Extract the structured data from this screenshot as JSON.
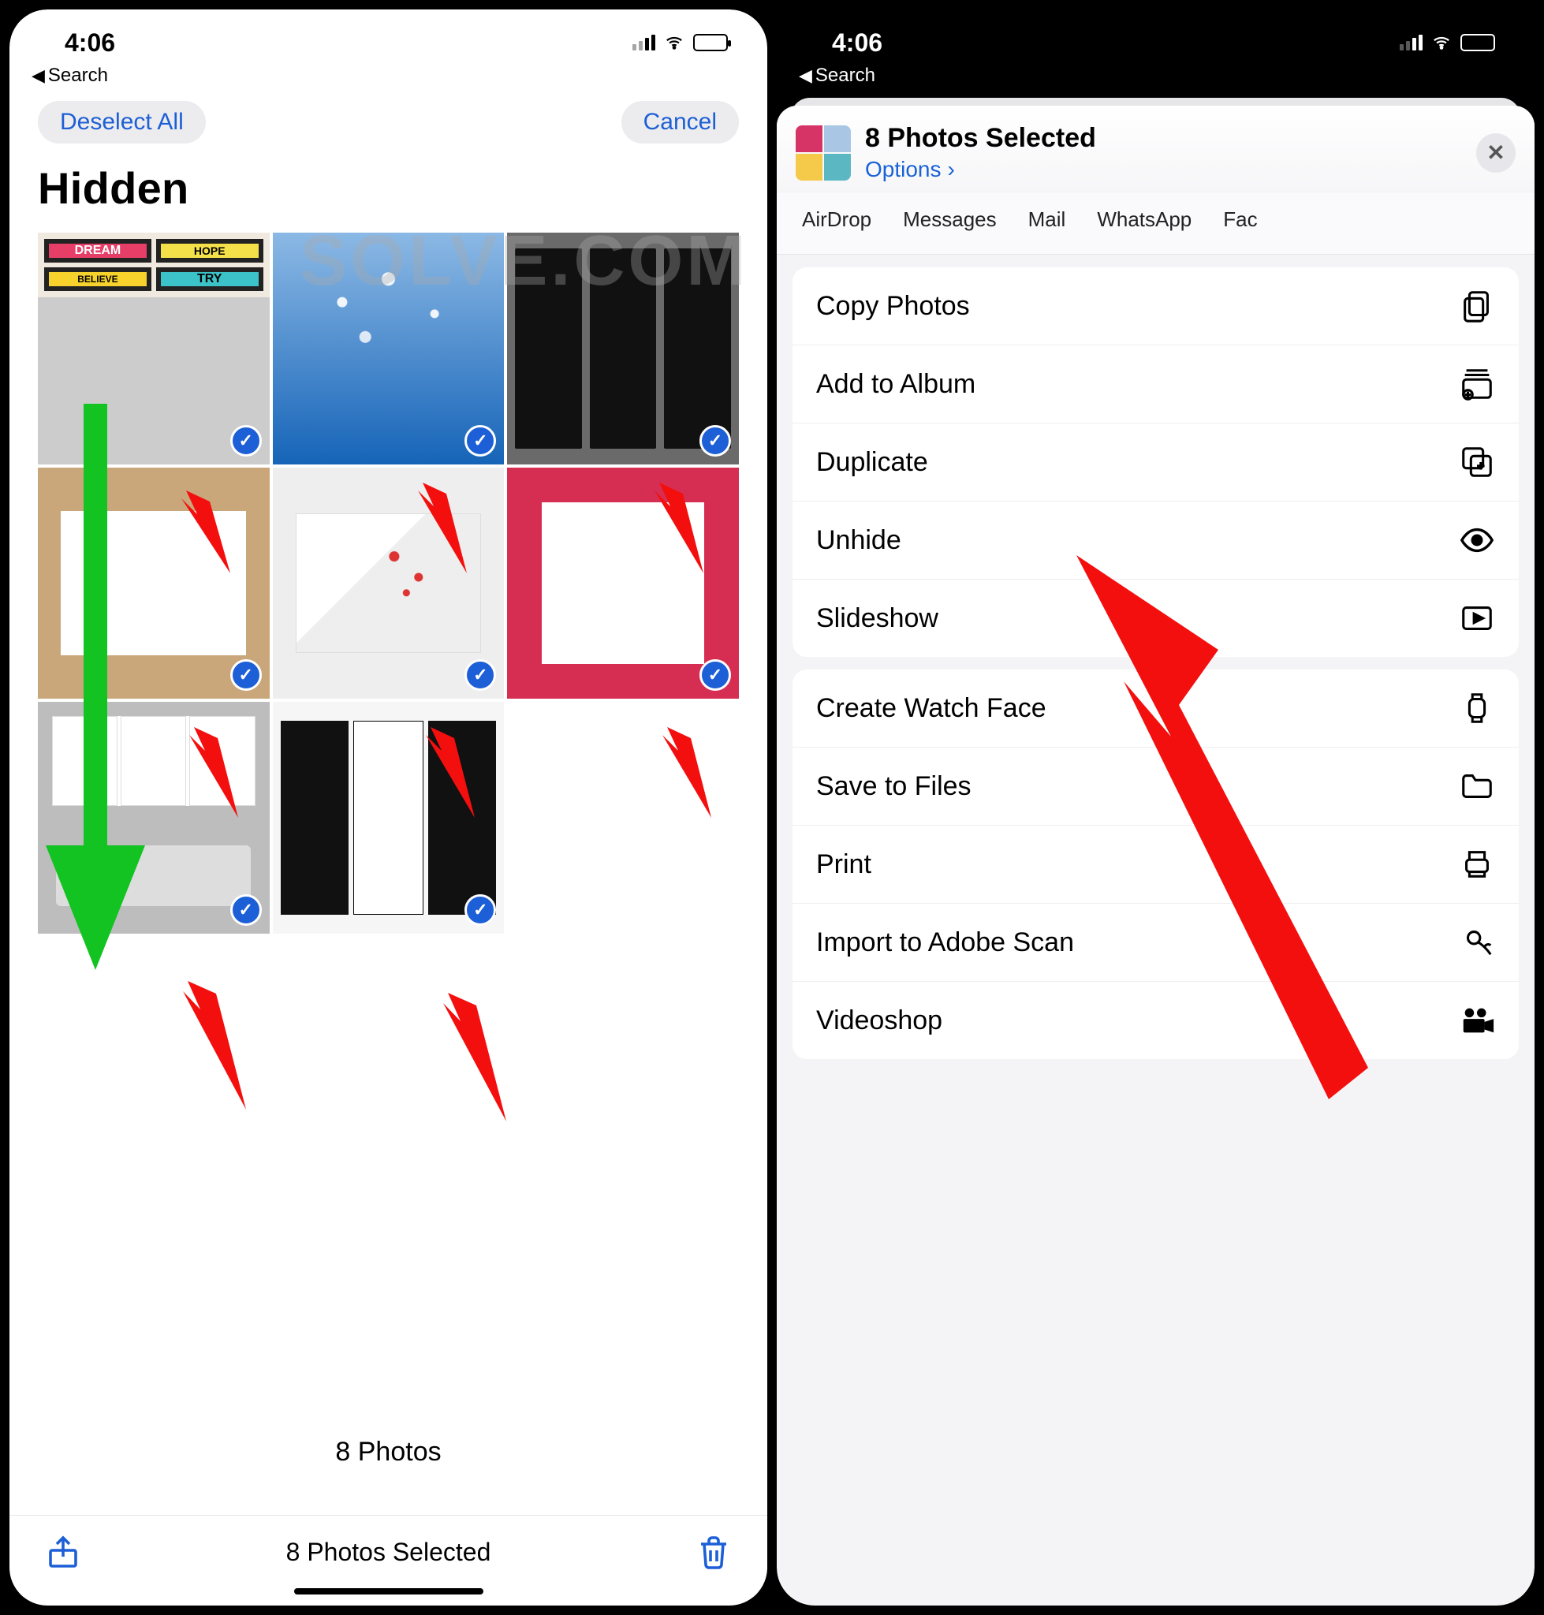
{
  "status": {
    "time": "4:06",
    "back_label": "Search"
  },
  "left": {
    "deselect": "Deselect All",
    "cancel": "Cancel",
    "title": "Hidden",
    "thumb_words": {
      "a": "DREAM",
      "b": "HOPE",
      "c": "BELIEVE",
      "d": "TRY"
    },
    "photo_count_text": "8 Photos",
    "toolbar_text": "8 Photos Selected"
  },
  "right": {
    "sheet_title": "8 Photos Selected",
    "options_label": "Options",
    "share_targets": [
      "AirDrop",
      "Messages",
      "Mail",
      "WhatsApp",
      "Fac"
    ],
    "group1": [
      {
        "label": "Copy Photos",
        "icon": "copy"
      },
      {
        "label": "Add to Album",
        "icon": "album"
      },
      {
        "label": "Duplicate",
        "icon": "dup"
      },
      {
        "label": "Unhide",
        "icon": "eye"
      },
      {
        "label": "Slideshow",
        "icon": "play"
      }
    ],
    "group2": [
      {
        "label": "Create Watch Face",
        "icon": "watch"
      },
      {
        "label": "Save to Files",
        "icon": "folder"
      },
      {
        "label": "Print",
        "icon": "print"
      },
      {
        "label": "Import to Adobe Scan",
        "icon": "adobe"
      },
      {
        "label": "Videoshop",
        "icon": "video"
      }
    ]
  },
  "watermark": "SOLVE.COM"
}
